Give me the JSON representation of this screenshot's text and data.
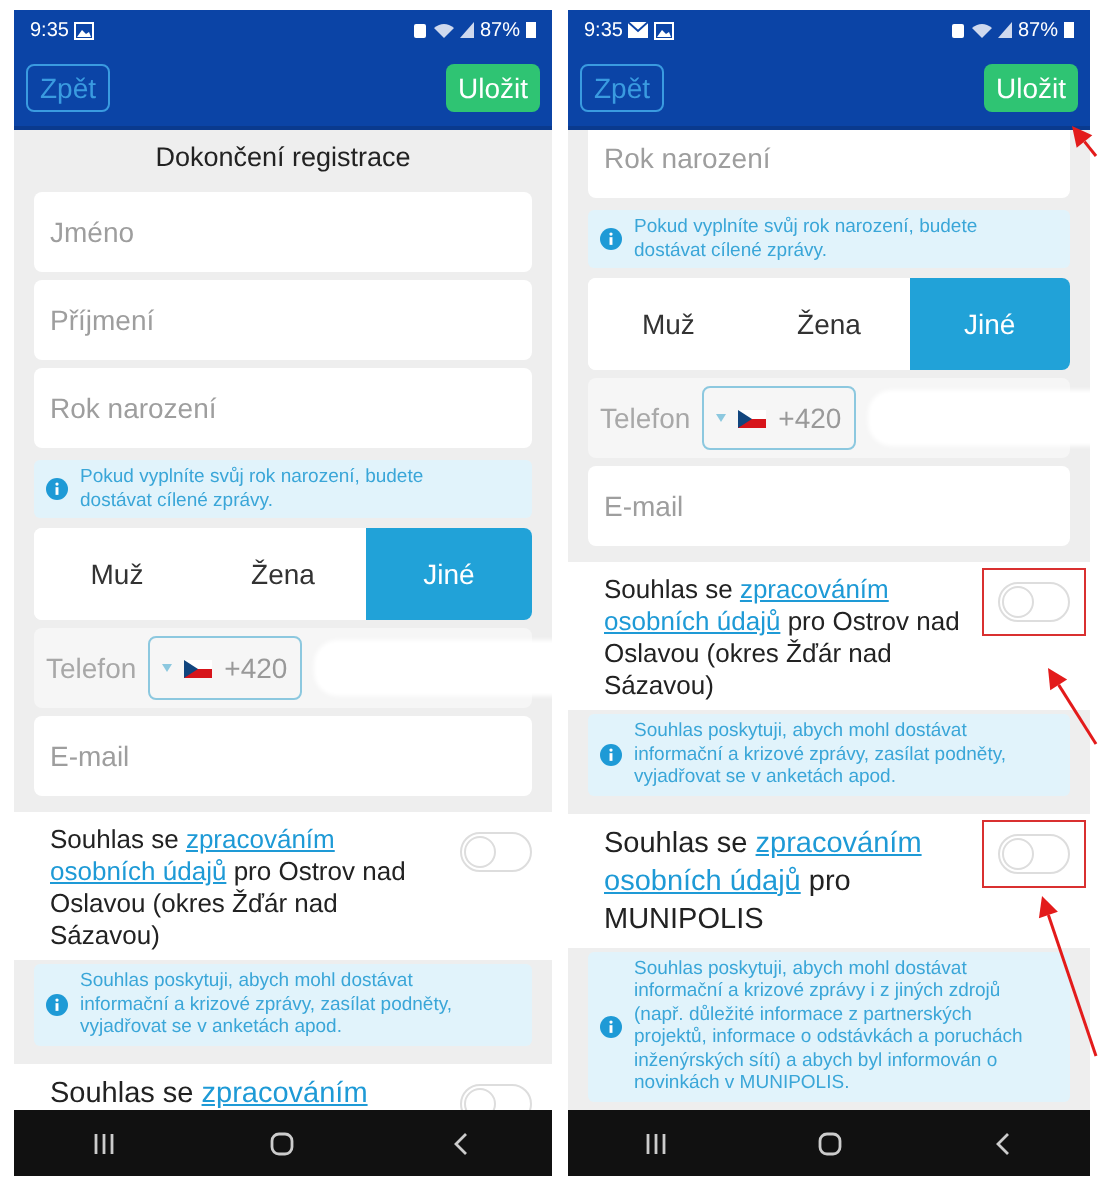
{
  "phones": [
    {
      "status": {
        "time": "9:35",
        "notifications": [
          {
            "kind": "image"
          }
        ],
        "battery": "87%"
      },
      "header": {
        "back": "Zpět",
        "save": "Uložit"
      },
      "title": "Dokončení registrace",
      "items": [
        {
          "kind": "field",
          "placeholder": "Jméno"
        },
        {
          "kind": "field",
          "placeholder": "Příjmení"
        },
        {
          "kind": "field",
          "placeholder": "Rok narození"
        },
        {
          "kind": "note",
          "text": "Pokud vyplníte svůj rok narození, budete dostávat cílené zprávy."
        },
        {
          "kind": "segment",
          "options": [
            {
              "label": "Muž",
              "selected": false
            },
            {
              "label": "Žena",
              "selected": false
            },
            {
              "label": "Jiné",
              "selected": true
            }
          ]
        },
        {
          "kind": "phone",
          "label": "Telefon",
          "code": "+420"
        },
        {
          "kind": "field",
          "placeholder": "E-mail"
        },
        {
          "kind": "consent",
          "parts": [
            {
              "kind": "text",
              "text": "Souhlas se"
            },
            {
              "kind": "link",
              "text": "zpracováním"
            },
            {
              "kind": "link",
              "text": "osobních údajů"
            },
            {
              "kind": "text",
              "text": "pro Ostrov nad Oslavou (okres Žďár nad Sázavou)"
            }
          ],
          "on": false,
          "highlighted": false
        },
        {
          "kind": "note",
          "text": "Souhlas poskytuji, abych mohl dostávat informační a krizové zprávy, zasílat podněty, vyjadřovat se v anketách apod."
        },
        {
          "kind": "consent-large",
          "parts": [
            {
              "kind": "text",
              "text": "Souhlas se"
            },
            {
              "kind": "link",
              "text": "zpracováním"
            }
          ],
          "on": false,
          "highlighted": false
        }
      ]
    },
    {
      "status": {
        "time": "9:35",
        "notifications": [
          {
            "kind": "mail"
          },
          {
            "kind": "image"
          }
        ],
        "battery": "87%"
      },
      "header": {
        "back": "Zpět",
        "save": "Uložit"
      },
      "items": [
        {
          "kind": "field",
          "placeholder": "Rok narození"
        },
        {
          "kind": "note",
          "text": "Pokud vyplníte svůj rok narození, budete dostávat cílené zprávy."
        },
        {
          "kind": "segment",
          "options": [
            {
              "label": "Muž",
              "selected": false
            },
            {
              "label": "Žena",
              "selected": false
            },
            {
              "label": "Jiné",
              "selected": true
            }
          ]
        },
        {
          "kind": "phone",
          "label": "Telefon",
          "code": "+420"
        },
        {
          "kind": "field",
          "placeholder": "E-mail"
        },
        {
          "kind": "consent",
          "parts": [
            {
              "kind": "text",
              "text": "Souhlas se"
            },
            {
              "kind": "link",
              "text": "zpracováním"
            },
            {
              "kind": "link",
              "text": "osobních údajů"
            },
            {
              "kind": "text",
              "text": "pro Ostrov nad Oslavou (okres Žďár nad Sázavou)"
            }
          ],
          "on": false,
          "highlighted": true
        },
        {
          "kind": "note",
          "text": "Souhlas poskytuji, abych mohl dostávat informační a krizové zprávy, zasílat podněty, vyjadřovat se v anketách apod."
        },
        {
          "kind": "consent-large",
          "parts": [
            {
              "kind": "text",
              "text": "Souhlas se"
            },
            {
              "kind": "link",
              "text": "zpracováním"
            },
            {
              "kind": "link",
              "text": "osobních údajů"
            },
            {
              "kind": "text",
              "text": "pro MUNIPOLIS"
            }
          ],
          "on": false,
          "highlighted": true
        },
        {
          "kind": "note",
          "text": "Souhlas poskytuji, abych mohl dostávat informační a krizové zprávy i z jiných zdrojů (např. důležité informace z partnerských projektů, informace o odstávkách a poruchách inženýrských sítí) a abych byl informován o novinkách v MUNIPOLIS."
        }
      ]
    }
  ]
}
